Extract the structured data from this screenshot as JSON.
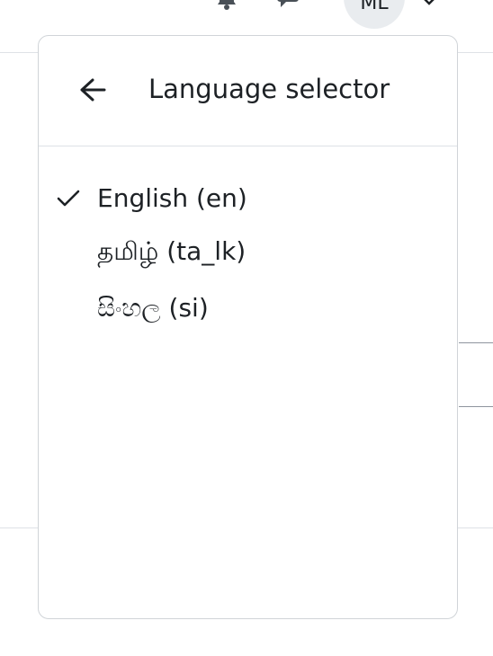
{
  "header": {
    "avatar_initials": "ML"
  },
  "language_menu": {
    "title": "Language selector",
    "back_icon": "arrow-left-icon",
    "items": [
      {
        "label": "English (en)",
        "selected": true
      },
      {
        "label": "தமிழ் (ta_lk)",
        "selected": false
      },
      {
        "label": "සිංහල (si)",
        "selected": false
      }
    ]
  },
  "colors": {
    "text": "#1d2125",
    "border": "#dee2e6",
    "avatar_bg": "#e9ecef"
  }
}
